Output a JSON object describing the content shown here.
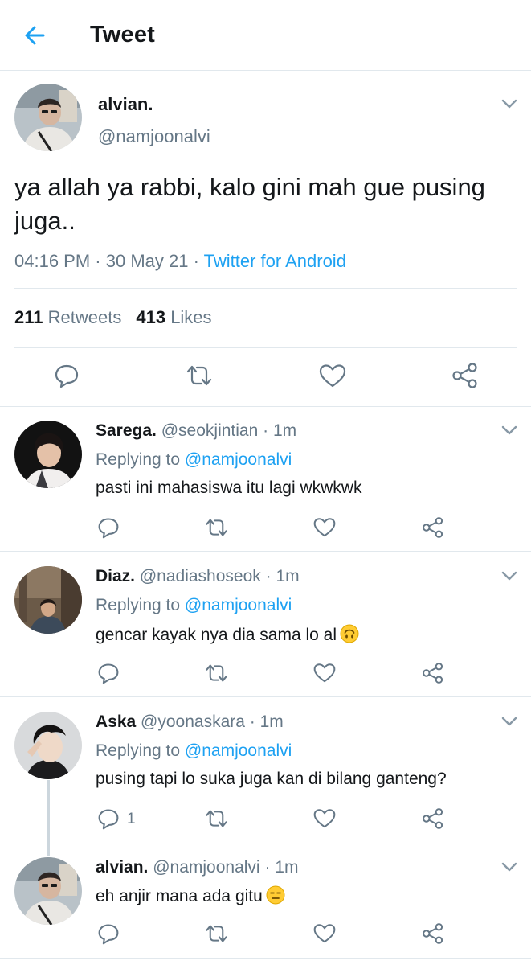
{
  "header": {
    "title": "Tweet",
    "back_icon": "arrow-left-icon"
  },
  "colors": {
    "accent": "#1da1f2",
    "secondary_text": "#657786",
    "divider": "#e1e8ed"
  },
  "main_tweet": {
    "name": "alvian.",
    "handle": "@namjoonalvi",
    "text": "ya allah ya rabbi, kalo gini mah gue pusing juga..",
    "time": "04:16 PM",
    "sep1": " · ",
    "date": "30 May 21",
    "sep2": " · ",
    "source": "Twitter for Android",
    "retweets_count": "211",
    "retweets_label": "Retweets",
    "likes_count": "413",
    "likes_label": "Likes"
  },
  "replies": [
    {
      "name": "Sarega.",
      "handle": "@seokjintian",
      "time": "· 1m",
      "replying_prefix": "Replying to",
      "replying_to": "@namjoonalvi",
      "text": "pasti ini mahasiswa itu lagi wkwkwk",
      "reply_count": ""
    },
    {
      "name": "Diaz.",
      "handle": "@nadiashoseok",
      "time": "· 1m",
      "replying_prefix": "Replying to",
      "replying_to": "@namjoonalvi",
      "text": "gencar kayak nya dia sama lo al",
      "emoji": "upside-down-face",
      "reply_count": ""
    },
    {
      "name": "Aska",
      "handle": "@yoonaskara",
      "time": "· 1m",
      "replying_prefix": "Replying to",
      "replying_to": "@namjoonalvi",
      "text": "pusing tapi lo suka juga kan di bilang ganteng?",
      "reply_count": "1"
    },
    {
      "name": "alvian.",
      "handle": "@namjoonalvi",
      "time": "· 1m",
      "text": "eh anjir mana ada gitu",
      "emoji": "expressionless-face",
      "reply_count": ""
    }
  ]
}
